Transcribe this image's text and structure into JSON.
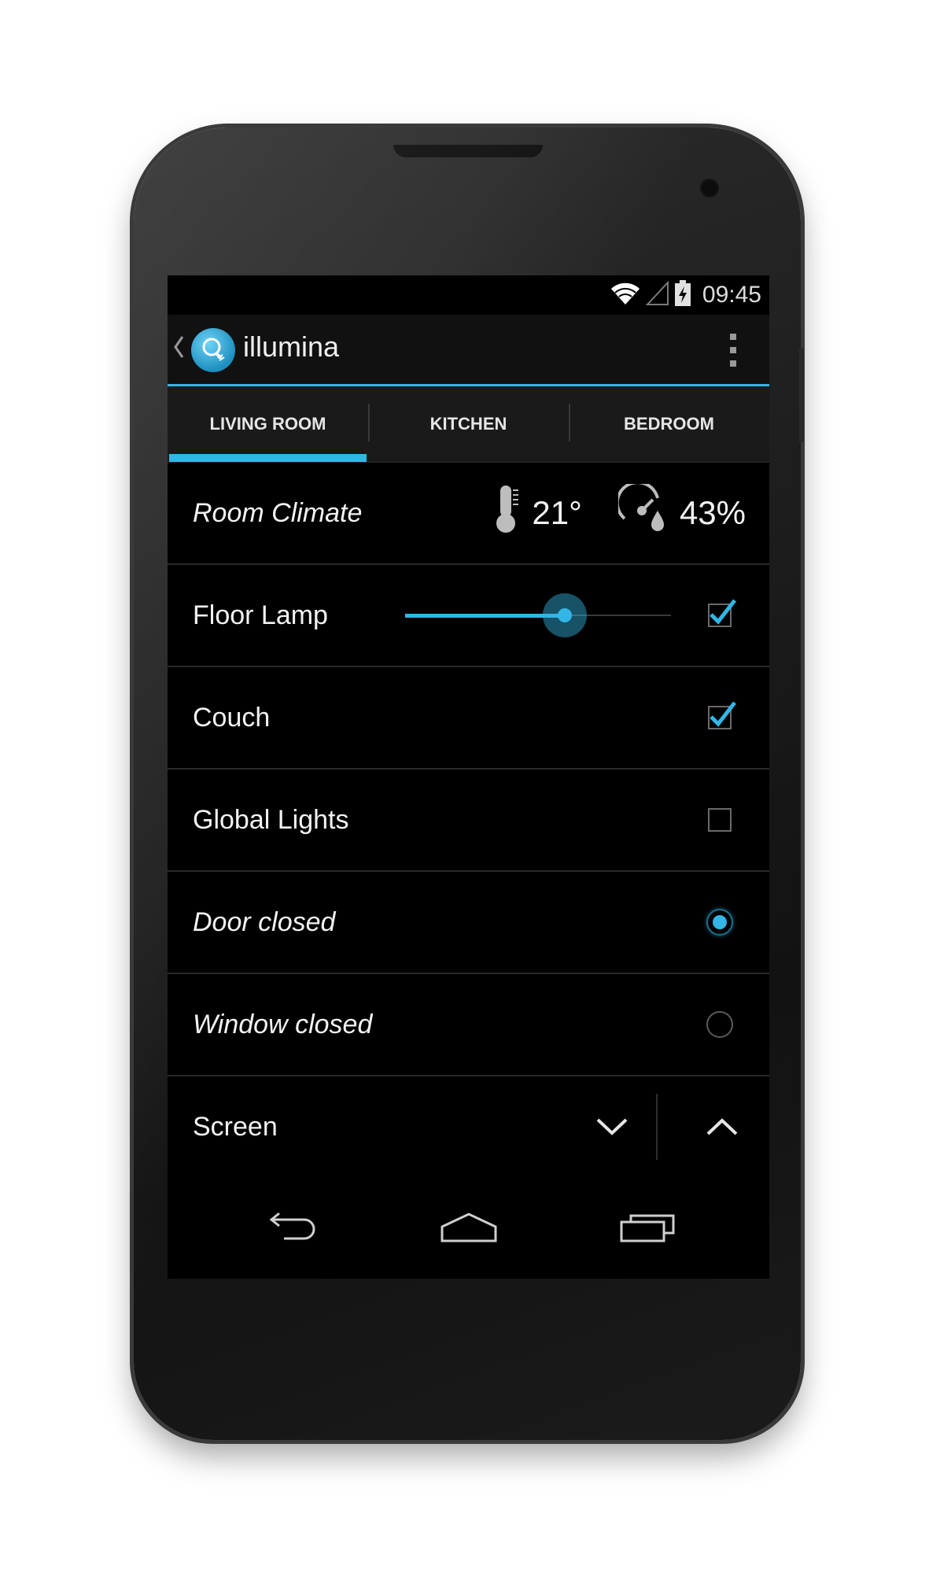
{
  "status_bar": {
    "time": "09:45",
    "icons": [
      "wifi-icon",
      "signal-icon",
      "battery-charging-icon"
    ]
  },
  "action_bar": {
    "title": "illumina",
    "icons": [
      "back-chevron-icon",
      "lightbulb-app-icon",
      "overflow-menu-icon"
    ]
  },
  "tabs": [
    {
      "label": "LIVING ROOM",
      "active": true
    },
    {
      "label": "KITCHEN",
      "active": false
    },
    {
      "label": "BEDROOM",
      "active": false
    }
  ],
  "climate": {
    "label": "Room Climate",
    "temperature": "21°",
    "humidity": "43%",
    "icons": [
      "thermometer-icon",
      "humidity-gauge-icon"
    ]
  },
  "items": {
    "floor_lamp": {
      "label": "Floor Lamp",
      "brightness": 0.6,
      "checked": true
    },
    "couch": {
      "label": "Couch",
      "checked": true
    },
    "global_lights": {
      "label": "Global Lights",
      "checked": false
    },
    "door": {
      "label": "Door closed",
      "selected": true
    },
    "window": {
      "label": "Window closed",
      "selected": false
    },
    "screen": {
      "label": "Screen",
      "icons": [
        "chevron-down-icon",
        "chevron-up-icon"
      ]
    }
  },
  "nav_bar": {
    "icons": [
      "back-icon",
      "home-icon",
      "recent-apps-icon"
    ]
  },
  "colors": {
    "accent": "#33b5e5",
    "background": "#000000",
    "tab_bar": "#1a1a1a",
    "divider": "#2a2a2a",
    "text": "#f2f2f2"
  }
}
